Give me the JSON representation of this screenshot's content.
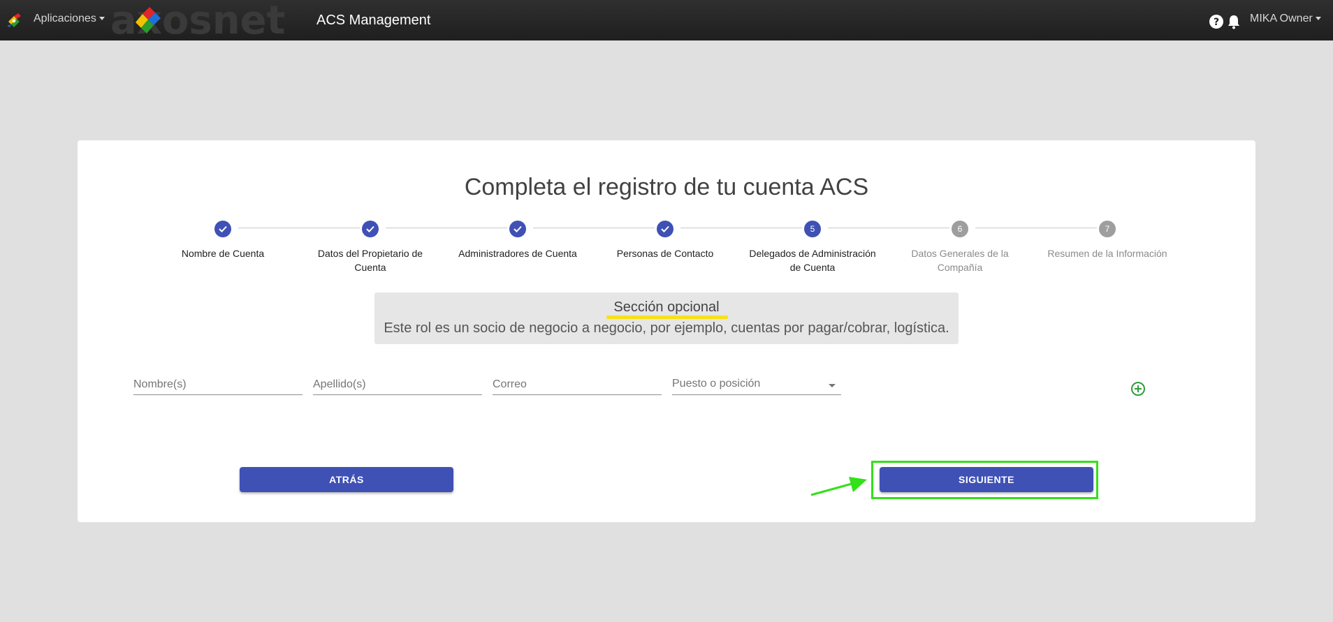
{
  "topbar": {
    "apps_label": "Aplicaciones",
    "brand_text": "axosnet",
    "title": "ACS Management",
    "user_label": "MIKA Owner"
  },
  "page": {
    "title": "Completa el registro de tu cuenta ACS"
  },
  "stepper": {
    "steps": [
      {
        "number": "1",
        "label_line1": "Nombre de Cuenta",
        "label_line2": "",
        "status": "done"
      },
      {
        "number": "2",
        "label_line1": "Datos del Propietario de",
        "label_line2": "Cuenta",
        "status": "done"
      },
      {
        "number": "3",
        "label_line1": "Administradores de Cuenta",
        "label_line2": "",
        "status": "done"
      },
      {
        "number": "4",
        "label_line1": "Personas de Contacto",
        "label_line2": "",
        "status": "done"
      },
      {
        "number": "5",
        "label_line1": "Delegados de Administración",
        "label_line2": "de Cuenta",
        "status": "active"
      },
      {
        "number": "6",
        "label_line1": "Datos Generales de la",
        "label_line2": "Compañía",
        "status": "todo"
      },
      {
        "number": "7",
        "label_line1": "Resumen de la Información",
        "label_line2": "",
        "status": "todo"
      }
    ]
  },
  "optional_section": {
    "title": "Sección opcional",
    "description": "Este rol es un socio de negocio a negocio, por ejemplo, cuentas por pagar/cobrar, logística."
  },
  "form": {
    "first_name_placeholder": "Nombre(s)",
    "last_name_placeholder": "Apellido(s)",
    "email_placeholder": "Correo",
    "position_placeholder": "Puesto o posición"
  },
  "buttons": {
    "back_label": "ATRÁS",
    "next_label": "SIGUIENTE"
  },
  "colors": {
    "primary": "#3f51b5",
    "pending": "#9e9e9e",
    "highlight": "#f7e11a",
    "annotation": "#33e01a",
    "add_icon": "#2e9e3a"
  }
}
